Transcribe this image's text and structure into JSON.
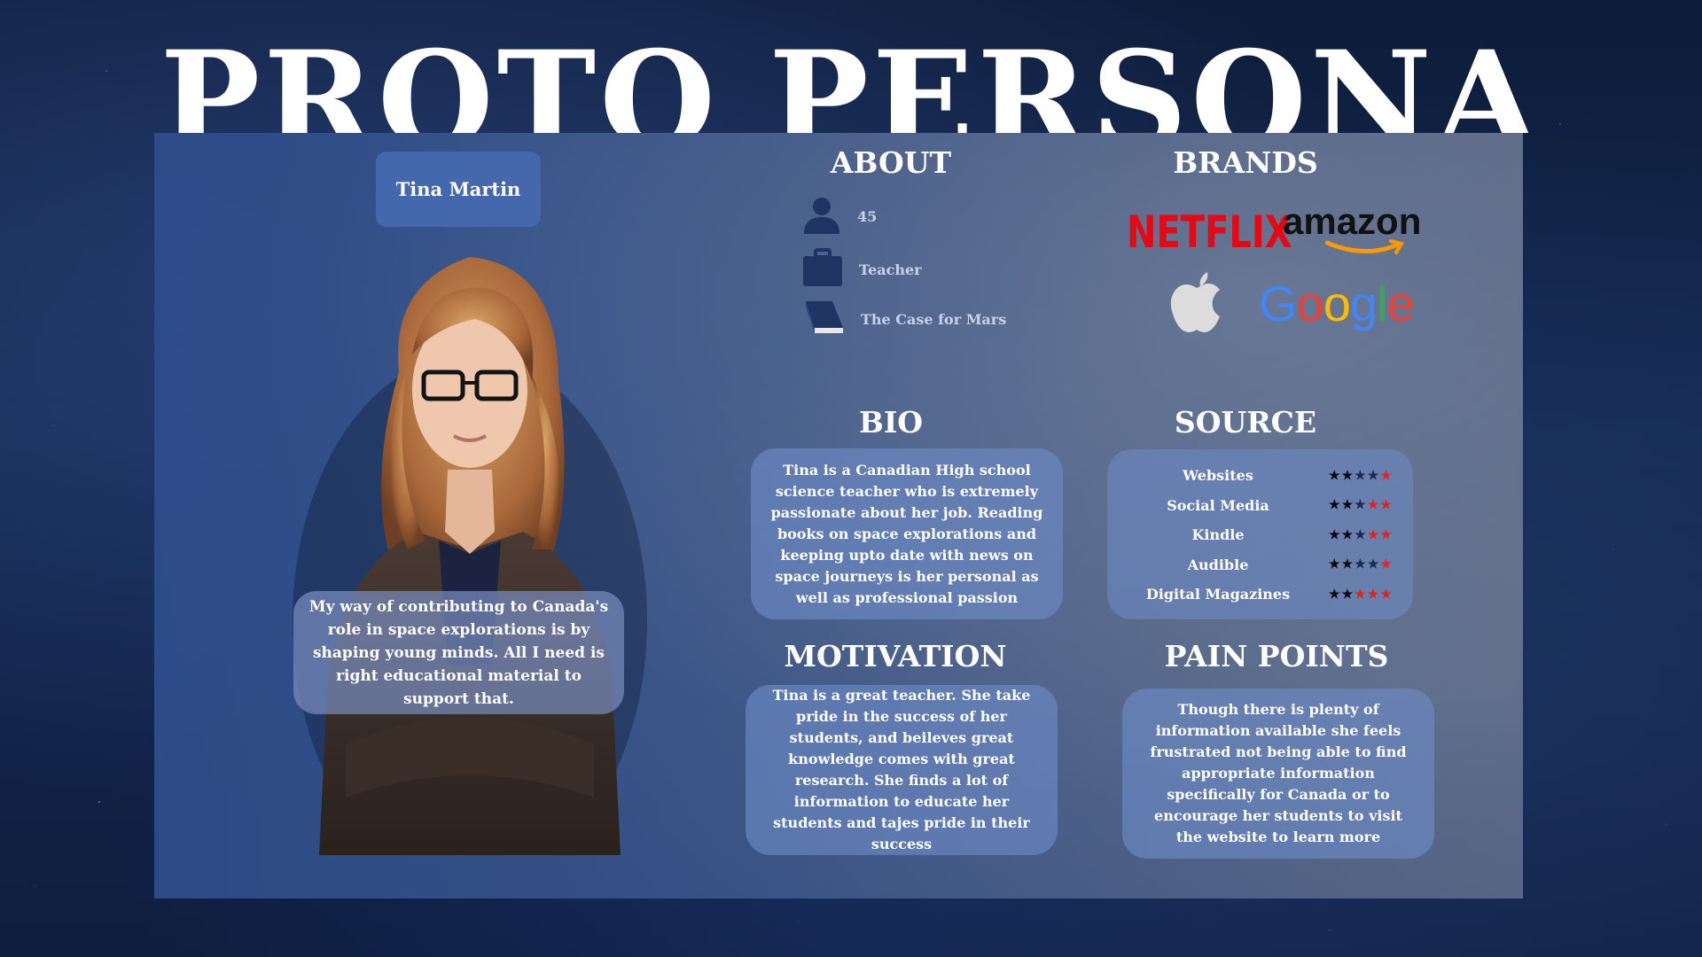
{
  "title": "PROTO PERSONA",
  "persona": {
    "name": "Tina Martin",
    "quote": "My way of contributing to Canada's role in space explorations is by shaping young minds. All I need is right educational material to support that."
  },
  "about": {
    "heading": "ABOUT",
    "items": [
      {
        "icon": "person-icon",
        "text": "45"
      },
      {
        "icon": "briefcase-icon",
        "text": "Teacher"
      },
      {
        "icon": "book-icon",
        "text": "The Case for Mars"
      }
    ]
  },
  "brands": {
    "heading": "BRANDS",
    "logos": [
      {
        "name": "netflix-logo",
        "text": "NETFLIX",
        "color": "#e50914"
      },
      {
        "name": "amazon-logo",
        "text": "amazon",
        "color": "#111111",
        "accent": "#ff9900"
      },
      {
        "name": "apple-logo",
        "color": "#dcdcdc"
      },
      {
        "name": "google-logo",
        "text": "Google",
        "colors": [
          "#4285f4",
          "#ea4335",
          "#fbbc05",
          "#4285f4",
          "#34a853",
          "#ea4335"
        ]
      }
    ]
  },
  "bio": {
    "heading": "BIO",
    "text": "Tina is a Canadian High school science teacher who is extremely passionate about her job. Reading books on space explorations and keeping upto date with news on space journeys is her personal as well as professional passion"
  },
  "source": {
    "heading": "SOURCE",
    "rows": [
      {
        "label": "Websites",
        "rating": 4
      },
      {
        "label": "Social Media",
        "rating": 3
      },
      {
        "label": "Kindle",
        "rating": 3
      },
      {
        "label": "Audible",
        "rating": 4
      },
      {
        "label": "Digital Magazines",
        "rating": 2
      }
    ],
    "max_rating": 5,
    "colors": {
      "filled": [
        "#0a0a0a",
        "#0a0a0a",
        "#1b2a55",
        "#1b2a55",
        "#1b2a55"
      ],
      "empty": "#e2231a"
    }
  },
  "motivation": {
    "heading": "MOTIVATION",
    "text": "Tina is a great teacher. She take pride in the success of her students, and beileves great knowledge comes with great research. She finds a lot of information to educate her students and tajes pride in their success"
  },
  "pain_points": {
    "heading": "PAIN POINTS",
    "text": "Though there is plenty of information available she feels frustrated not being able to find appropriate information specifically for Canada or to encourage her students to visit the website to learn more"
  }
}
